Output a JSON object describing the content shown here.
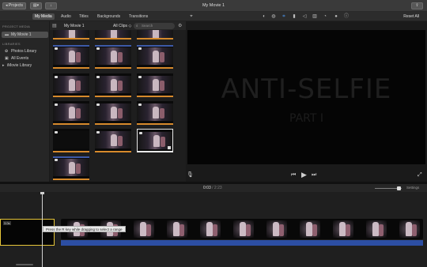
{
  "titlebar": {
    "projects_label": "◂ Projects",
    "window_title": "My Movie 1"
  },
  "media_tabs": [
    "My Media",
    "Audio",
    "Titles",
    "Backgrounds",
    "Transitions"
  ],
  "toolbar": {
    "reset_all": "Reset All"
  },
  "sidebar": {
    "project_media_head": "PROJECT MEDIA",
    "project_item": "My Movie 1",
    "libraries_head": "LIBRARIES",
    "library_items": [
      "Photos Library",
      "All Events",
      "iMovie Library"
    ]
  },
  "browser": {
    "title": "My Movie 1",
    "clips_filter": "All Clips ◇",
    "search_placeholder": "Search"
  },
  "viewer": {
    "title_line1": "ANTI-SELFIE",
    "title_line2": "PART I"
  },
  "timeline": {
    "current_time": "0:03",
    "total_time": "2:23",
    "settings_label": "Settings",
    "title_clip_label": "3.0s",
    "tooltip": "Press the R key while dragging to select a range"
  },
  "icons": {
    "clip_view": "▭",
    "library_toggle": "▤",
    "gear": "⚙",
    "magic_wand": "✎",
    "mic": "🎙",
    "prev": "⏮",
    "play": "▶",
    "next": "⏭",
    "fullscreen": "⤢"
  }
}
